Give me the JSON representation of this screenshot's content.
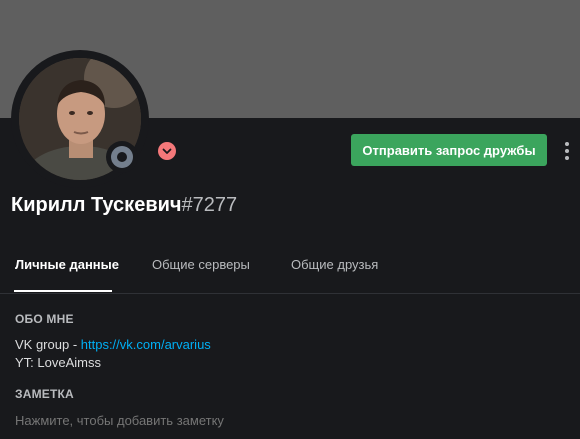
{
  "profile": {
    "username": "Кирилл Тускевич",
    "discriminator": "#7277",
    "avatar_icon": "user-avatar-photo",
    "status": "offline",
    "status_color": "#747f8d",
    "badge_icon": "nitro-badge-icon",
    "badge_color": "#f4787a",
    "banner_color": "#5f5f5f"
  },
  "actions": {
    "friend_request_label": "Отправить запрос дружбы",
    "friend_request_color": "#3ba55d",
    "more_icon": "more-vertical-icon"
  },
  "tabs": [
    {
      "label": "Личные данные",
      "active": true
    },
    {
      "label": "Общие серверы",
      "active": false
    },
    {
      "label": "Общие друзья",
      "active": false
    }
  ],
  "about": {
    "title": "Обо мне",
    "line1_prefix": "VK group - ",
    "line1_link": "https://vk.com/arvarius",
    "line2": "YT: LoveAimss"
  },
  "note": {
    "title": "Заметка",
    "placeholder": "Нажмите, чтобы добавить заметку"
  },
  "accent_link_color": "#00aff4"
}
